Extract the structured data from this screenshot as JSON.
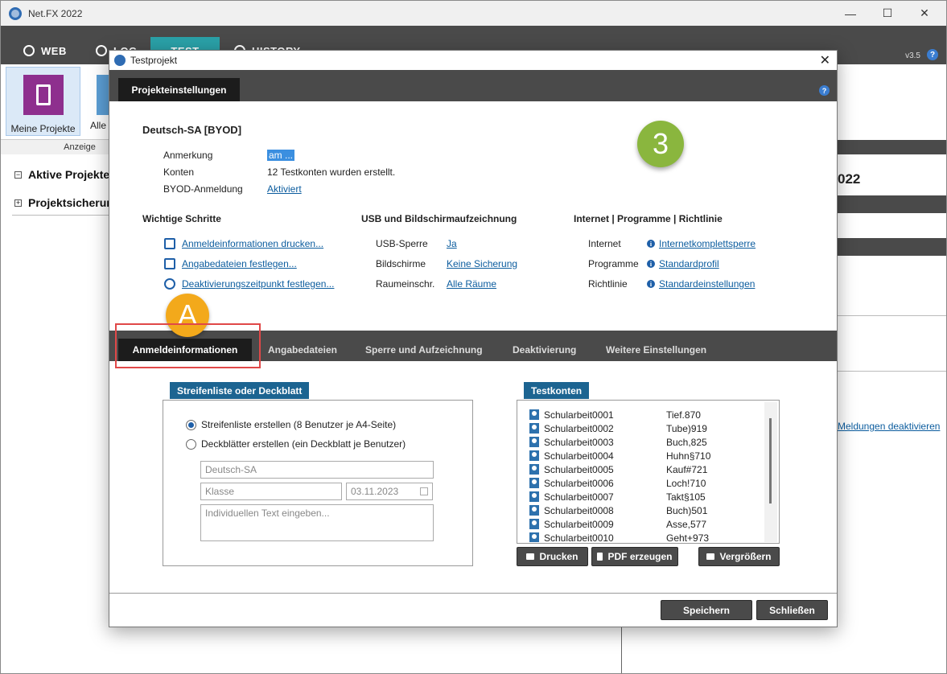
{
  "app": {
    "title": "Net.FX 2022",
    "window_controls": {
      "minimize": "—",
      "maximize": "☐",
      "close": "✕"
    },
    "tabs": [
      {
        "label": "WEB"
      },
      {
        "label": "LOG"
      },
      {
        "label": "TEST"
      },
      {
        "label": "HISTORY"
      }
    ],
    "version": "v3.5",
    "help": "?",
    "ribbon": {
      "meine_projekte": "Meine Projekte",
      "alle": "Alle",
      "group_label": "Anzeige"
    },
    "tree": {
      "aktive": "Aktive Projekte",
      "sicher": "Projektsicherungen",
      "expander": "+",
      "collapser": "−"
    },
    "right_pane": {
      "year": "022",
      "link": "Meldungen deaktivieren"
    }
  },
  "dialog": {
    "title": "Testprojekt",
    "close": "✕",
    "tab": "Projekteinstellungen",
    "help": "?",
    "project_name": "Deutsch-SA [BYOD]",
    "fields": [
      {
        "label": "Anmerkung",
        "value": "am ..."
      },
      {
        "label": "Konten",
        "value": "12 Testkonten wurden erstellt."
      },
      {
        "label": "BYOD-Anmeldung",
        "value": "Aktiviert"
      }
    ],
    "badge_3": "3",
    "badge_a": "A",
    "sections": {
      "steps": "Wichtige Schritte",
      "usb": "USB und Bildschirmaufzeichnung",
      "net": "Internet | Programme | Richtlinie"
    },
    "steps": [
      "Anmeldeinformationen drucken...",
      "Angabedateien festlegen...",
      "Deaktivierungszeitpunkt festlegen..."
    ],
    "usb": [
      {
        "label": "USB-Sperre",
        "value": "Ja"
      },
      {
        "label": "Bildschirme",
        "value": "Keine Sicherung"
      },
      {
        "label": "Raumeinschr.",
        "value": "Alle Räume"
      }
    ],
    "net": [
      {
        "label": "Internet",
        "value": "Internetkomplettsperre"
      },
      {
        "label": "Programme",
        "value": "Standardprofil"
      },
      {
        "label": "Richtlinie",
        "value": "Standardeinstellungen"
      }
    ],
    "bottom_tabs": [
      "Anmeldeinformationen",
      "Angabedateien",
      "Sperre und Aufzeichnung",
      "Deaktivierung",
      "Weitere Einstellungen"
    ],
    "streifen": {
      "title": "Streifenliste oder Deckblatt",
      "option1": "Streifenliste erstellen (8 Benutzer je A4-Seite)",
      "option2": "Deckblätter erstellen (ein Deckblatt je Benutzer)",
      "name_placeholder": "Deutsch-SA",
      "klasse_placeholder": "Klasse",
      "date": "03.11.2023",
      "text_placeholder": "Individuellen Text eingeben..."
    },
    "testkonten": {
      "title": "Testkonten",
      "rows": [
        {
          "user": "Schularbeit0001",
          "pw": "Tief.870"
        },
        {
          "user": "Schularbeit0002",
          "pw": "Tube)919"
        },
        {
          "user": "Schularbeit0003",
          "pw": "Buch,825"
        },
        {
          "user": "Schularbeit0004",
          "pw": "Huhn§710"
        },
        {
          "user": "Schularbeit0005",
          "pw": "Kauf#721"
        },
        {
          "user": "Schularbeit0006",
          "pw": "Loch!710"
        },
        {
          "user": "Schularbeit0007",
          "pw": "Takt§105"
        },
        {
          "user": "Schularbeit0008",
          "pw": "Buch)501"
        },
        {
          "user": "Schularbeit0009",
          "pw": "Asse,577"
        },
        {
          "user": "Schularbeit0010",
          "pw": "Geht+973"
        }
      ]
    },
    "buttons": {
      "drucken": "Drucken",
      "pdf": "PDF erzeugen",
      "vergr": "Vergrößern",
      "speichern": "Speichern",
      "schliessen": "Schließen"
    }
  }
}
